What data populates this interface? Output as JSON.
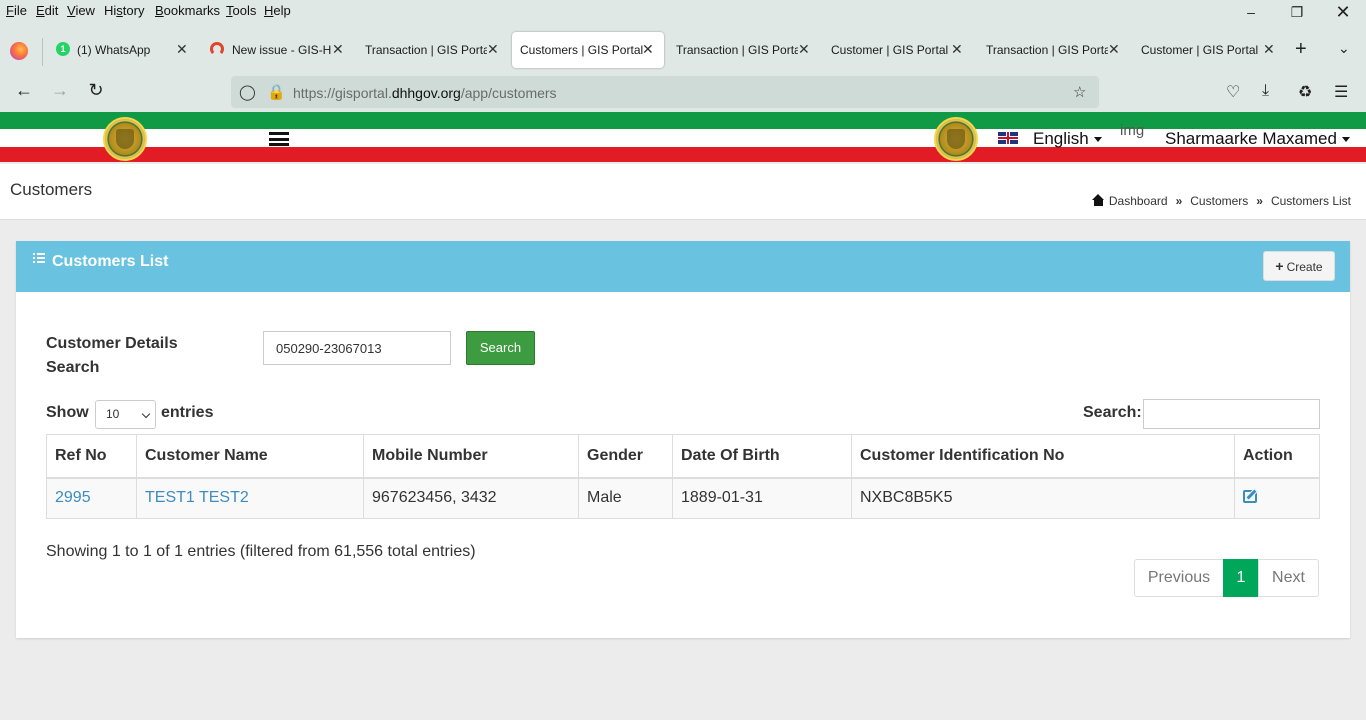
{
  "browser": {
    "menu": [
      "File",
      "Edit",
      "View",
      "History",
      "Bookmarks",
      "Tools",
      "Help"
    ],
    "menu_access_keys": [
      "F",
      "E",
      "V",
      "s",
      "B",
      "T",
      "H"
    ],
    "tabs": [
      {
        "label": "(1) WhatsApp",
        "icon": "whatsapp-icon",
        "badge": "1"
      },
      {
        "label": "New issue - GIS-H",
        "icon": "gitlab-icon"
      },
      {
        "label": "Transaction | GIS Portal"
      },
      {
        "label": "Customers | GIS Portal",
        "active": true
      },
      {
        "label": "Transaction | GIS Portal"
      },
      {
        "label": "Customer | GIS Portal"
      },
      {
        "label": "Transaction | GIS Portal"
      },
      {
        "label": "Customer | GIS Portal"
      }
    ],
    "url_prefix": "https://gisportal.",
    "url_domain": "dhhgov.org",
    "url_suffix": "/app/customers"
  },
  "header": {
    "language": "English",
    "img_alt": "img",
    "user_name": "Sharmaarke Maxamed",
    "stripe_colors": {
      "green": "#109a45",
      "white": "#ffffff",
      "red": "#e11c25"
    }
  },
  "page": {
    "title": "Customers",
    "breadcrumb": [
      "Dashboard",
      "Customers",
      "Customers List"
    ],
    "breadcrumb_sep": "»"
  },
  "box": {
    "title": "Customers List",
    "create_label": "Create",
    "header_color": "#69c3e0"
  },
  "search": {
    "label": "Customer Details Search",
    "value": "050290-23067013",
    "button": "Search"
  },
  "table_controls": {
    "show": "Show",
    "entries_value": "10",
    "entries": "entries",
    "filter_label": "Search:"
  },
  "table": {
    "columns": [
      "Ref No",
      "Customer Name",
      "Mobile Number",
      "Gender",
      "Date Of Birth",
      "Customer Identification No",
      "Action"
    ],
    "rows": [
      {
        "ref_no": "2995",
        "name": "TEST1 TEST2",
        "mobile": "967623456, 3432",
        "gender": "Male",
        "dob": "1889-01-31",
        "id_no": "NXBC8B5K5"
      }
    ]
  },
  "footer": {
    "info": "Showing 1 to 1 of 1 entries (filtered from 61,556 total entries)",
    "previous": "Previous",
    "page": "1",
    "next": "Next"
  }
}
